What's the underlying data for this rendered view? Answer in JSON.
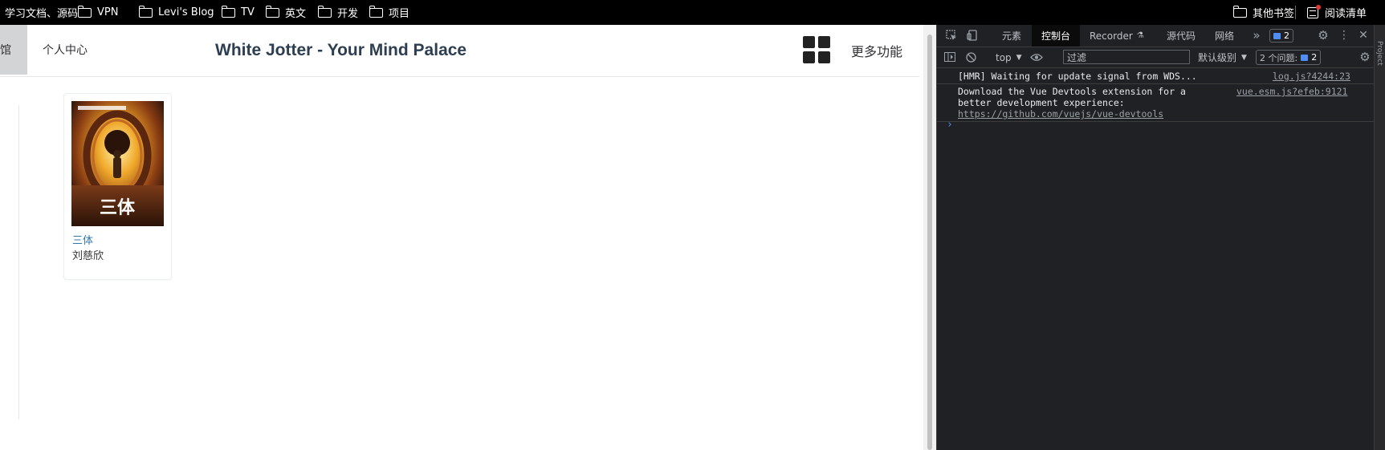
{
  "bookmarks": {
    "items": [
      "学习文档、源码",
      "VPN",
      "Levi's Blog",
      "TV",
      "英文",
      "开发",
      "项目"
    ],
    "right_items": [
      "其他书签",
      "阅读清单"
    ]
  },
  "nav": {
    "active_item_partial": "馆",
    "user_center": "个人中心",
    "site_title": "White Jotter - Your Mind Palace",
    "more_functions": "更多功能"
  },
  "book": {
    "title": "三体",
    "author": "刘慈欣",
    "cover_title": "三体"
  },
  "devtools": {
    "tabs": [
      "元素",
      "控制台",
      "Recorder",
      "源代码",
      "网络"
    ],
    "active_tab": "控制台",
    "issues_badge": "2",
    "context": "top",
    "filter_placeholder": "过滤",
    "log_level": "默认级别",
    "issues_label": "2 个问题:",
    "issues_count": "2",
    "side_label": "Project",
    "logs": [
      {
        "text": "[HMR] Waiting for update signal from WDS...",
        "source": "log.js?4244:23"
      },
      {
        "text": "Download the Vue Devtools extension for a",
        "text2": "better development experience:",
        "link": "https://github.com/vuejs/vue-devtools",
        "source": "vue.esm.js?efeb:9121"
      }
    ],
    "prompt": "›"
  },
  "colors": {
    "accent_link": "#3377aa",
    "devtools_bg": "#202124",
    "badge_blue": "#4f8df5"
  }
}
